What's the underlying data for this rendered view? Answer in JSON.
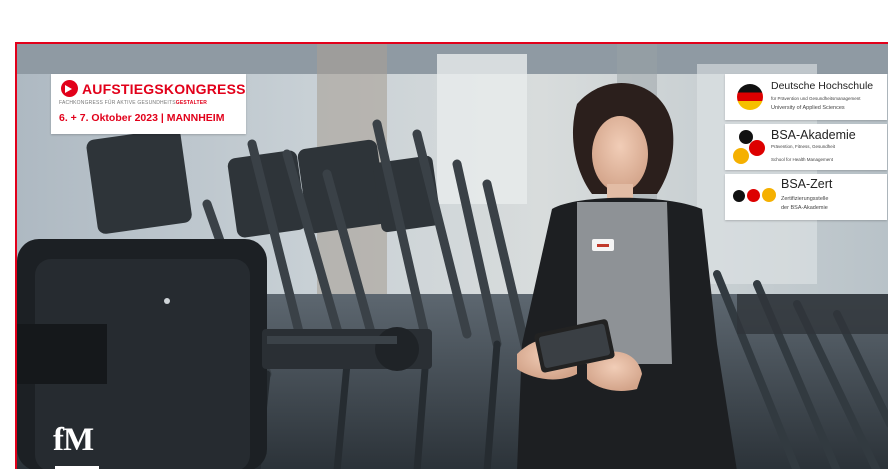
{
  "aufstiegskongress": {
    "title": "AUFSTIEGSKONGRESS",
    "subtitle_prefix": "FACHKONGRESS FÜR AKTIVE GESUNDHEITS",
    "subtitle_highlight": "GESTALTER",
    "date_location": "6. + 7. Oktober 2023 | MANNHEIM"
  },
  "partners": [
    {
      "name": "Deutsche Hochschule",
      "lines": [
        "für Prävention und Gesundheitsmanagement",
        "University of Applied Sciences"
      ]
    },
    {
      "name": "BSA-Akademie",
      "lines": [
        "Prävention, Fitness, Gesundheit",
        "School for Health Management"
      ]
    },
    {
      "name": "BSA-Zert",
      "lines": [
        "Zertifizierungsstelle",
        "der BSA-Akademie"
      ]
    }
  ],
  "brand_logo": "fM",
  "colors": {
    "accent": "#e2001a"
  }
}
